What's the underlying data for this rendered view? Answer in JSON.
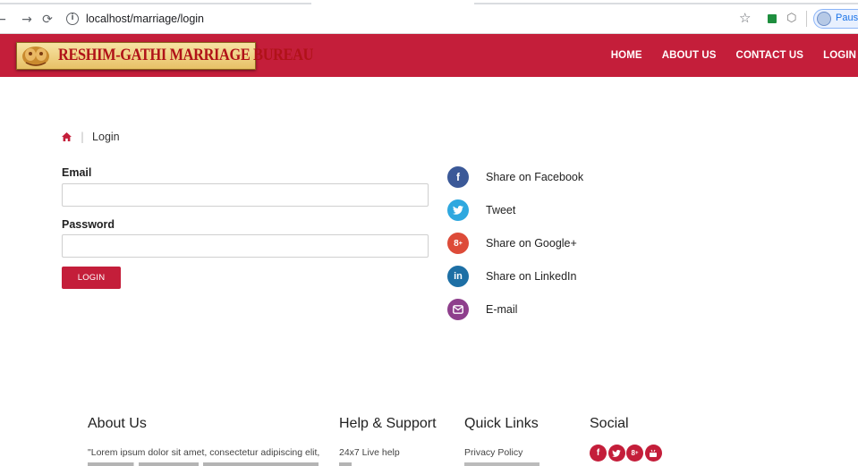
{
  "browser": {
    "url": "localhost/marriage/login",
    "profile_status": "Paused"
  },
  "header": {
    "logo_text": "RESHIM-GATHI MARRIAGE BUREAU",
    "brand_color": "#c41e3a",
    "nav": [
      {
        "label": "HOME"
      },
      {
        "label": "ABOUT US"
      },
      {
        "label": "CONTACT US"
      },
      {
        "label": "LOGIN"
      }
    ]
  },
  "breadcrumb": {
    "separator": "|",
    "current": "Login"
  },
  "form": {
    "email_label": "Email",
    "email_value": "",
    "password_label": "Password",
    "password_value": "",
    "submit_label": "LOGIN"
  },
  "share": [
    {
      "label": "Share on Facebook",
      "icon": "facebook-icon",
      "glyph": "f",
      "color": "#3b5998"
    },
    {
      "label": "Tweet",
      "icon": "twitter-icon",
      "glyph": "t",
      "color": "#2fa8df"
    },
    {
      "label": "Share on Google+",
      "icon": "google-plus-icon",
      "glyph": "g+",
      "color": "#dd4b39"
    },
    {
      "label": "Share on LinkedIn",
      "icon": "linkedin-icon",
      "glyph": "in",
      "color": "#1d6fa5"
    },
    {
      "label": "E-mail",
      "icon": "email-icon",
      "glyph": "✉",
      "color": "#8e3f8c"
    }
  ],
  "footer": {
    "about_heading": "About Us",
    "about_text": "\"Lorem ipsum dolor sit amet, consectetur adipiscing elit,",
    "help_heading": "Help & Support",
    "help_items": [
      "24x7 Live help"
    ],
    "quick_heading": "Quick Links",
    "quick_items": [
      "Privacy Policy"
    ],
    "social_heading": "Social",
    "social_icons": [
      {
        "icon": "facebook-icon",
        "glyph": "f"
      },
      {
        "icon": "twitter-icon",
        "glyph": "t"
      },
      {
        "icon": "google-plus-icon",
        "glyph": "g+"
      },
      {
        "icon": "youtube-icon",
        "glyph": "▶"
      }
    ]
  }
}
